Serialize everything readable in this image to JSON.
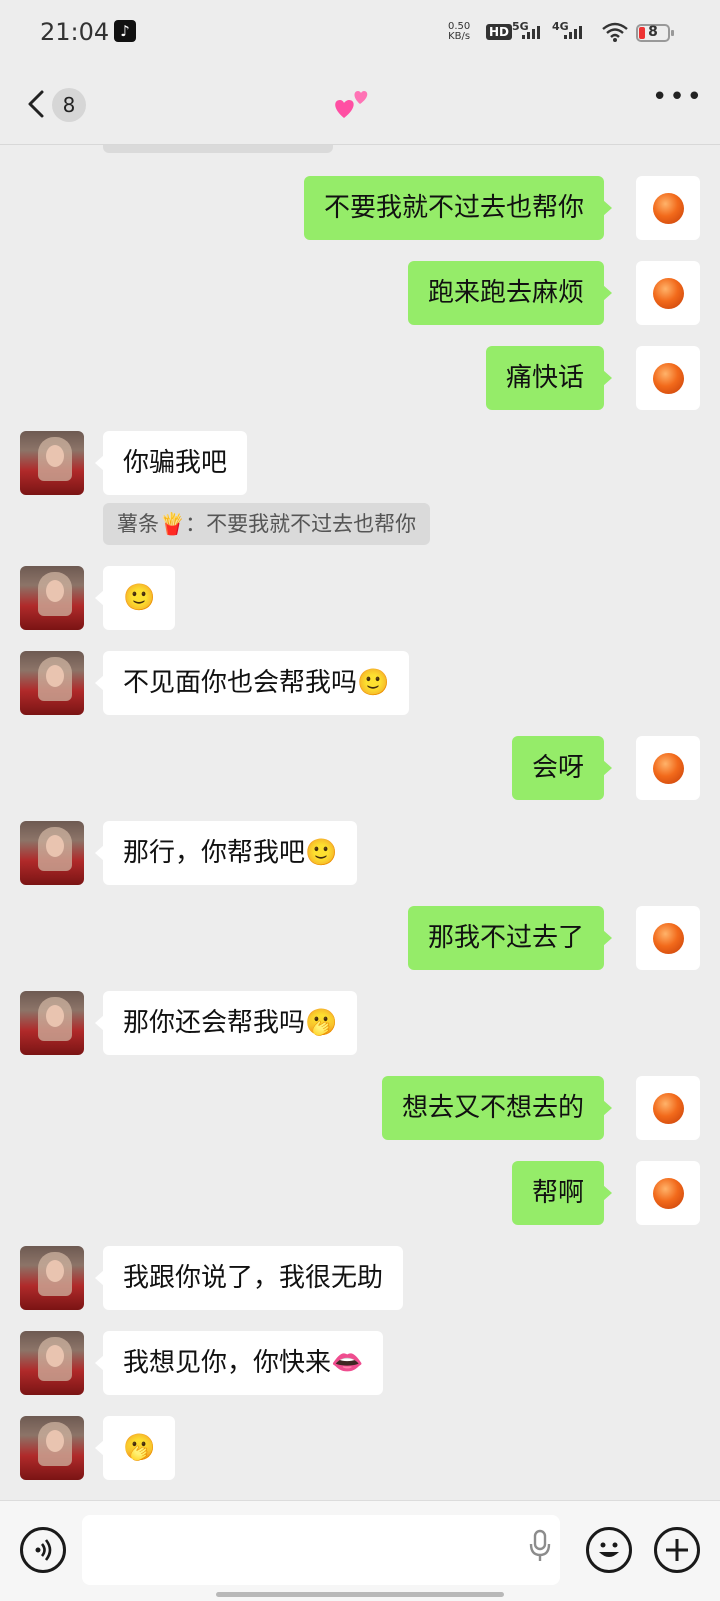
{
  "status_bar": {
    "time": "21:04",
    "net_speed": "0.50",
    "net_unit": "KB/s",
    "hd": "HD",
    "sim1": "5G",
    "sim2": "4G",
    "battery": "8"
  },
  "nav": {
    "unread_count": "8",
    "title_icon": "two-hearts-emoji",
    "more_icon": "more-dots-icon"
  },
  "messages": [
    {
      "side": "out",
      "text": "不要我就不过去也帮你"
    },
    {
      "side": "out",
      "text": "跑来跑去麻烦"
    },
    {
      "side": "out",
      "text": "痛快话"
    },
    {
      "side": "in",
      "text": "你骗我吧",
      "quote": "薯条🍟：不要我就不过去也帮你"
    },
    {
      "side": "in",
      "text": "🙂"
    },
    {
      "side": "in",
      "text": "不见面你也会帮我吗🙂"
    },
    {
      "side": "out",
      "text": "会呀"
    },
    {
      "side": "in",
      "text": "那行，你帮我吧🙂"
    },
    {
      "side": "out",
      "text": "那我不过去了"
    },
    {
      "side": "in",
      "text": "那你还会帮我吗🫢"
    },
    {
      "side": "out",
      "text": "想去又不想去的"
    },
    {
      "side": "out",
      "text": "帮啊"
    },
    {
      "side": "in",
      "text": "我跟你说了，我很无助"
    },
    {
      "side": "in",
      "text": "我想见你，你快来👄"
    },
    {
      "side": "in",
      "text": "🫢"
    }
  ],
  "input_bar": {
    "voice_icon": "voice-mode-icon",
    "mic_icon": "microphone-icon",
    "emoji_icon": "emoji-icon",
    "plus_icon": "plus-icon",
    "placeholder": ""
  }
}
